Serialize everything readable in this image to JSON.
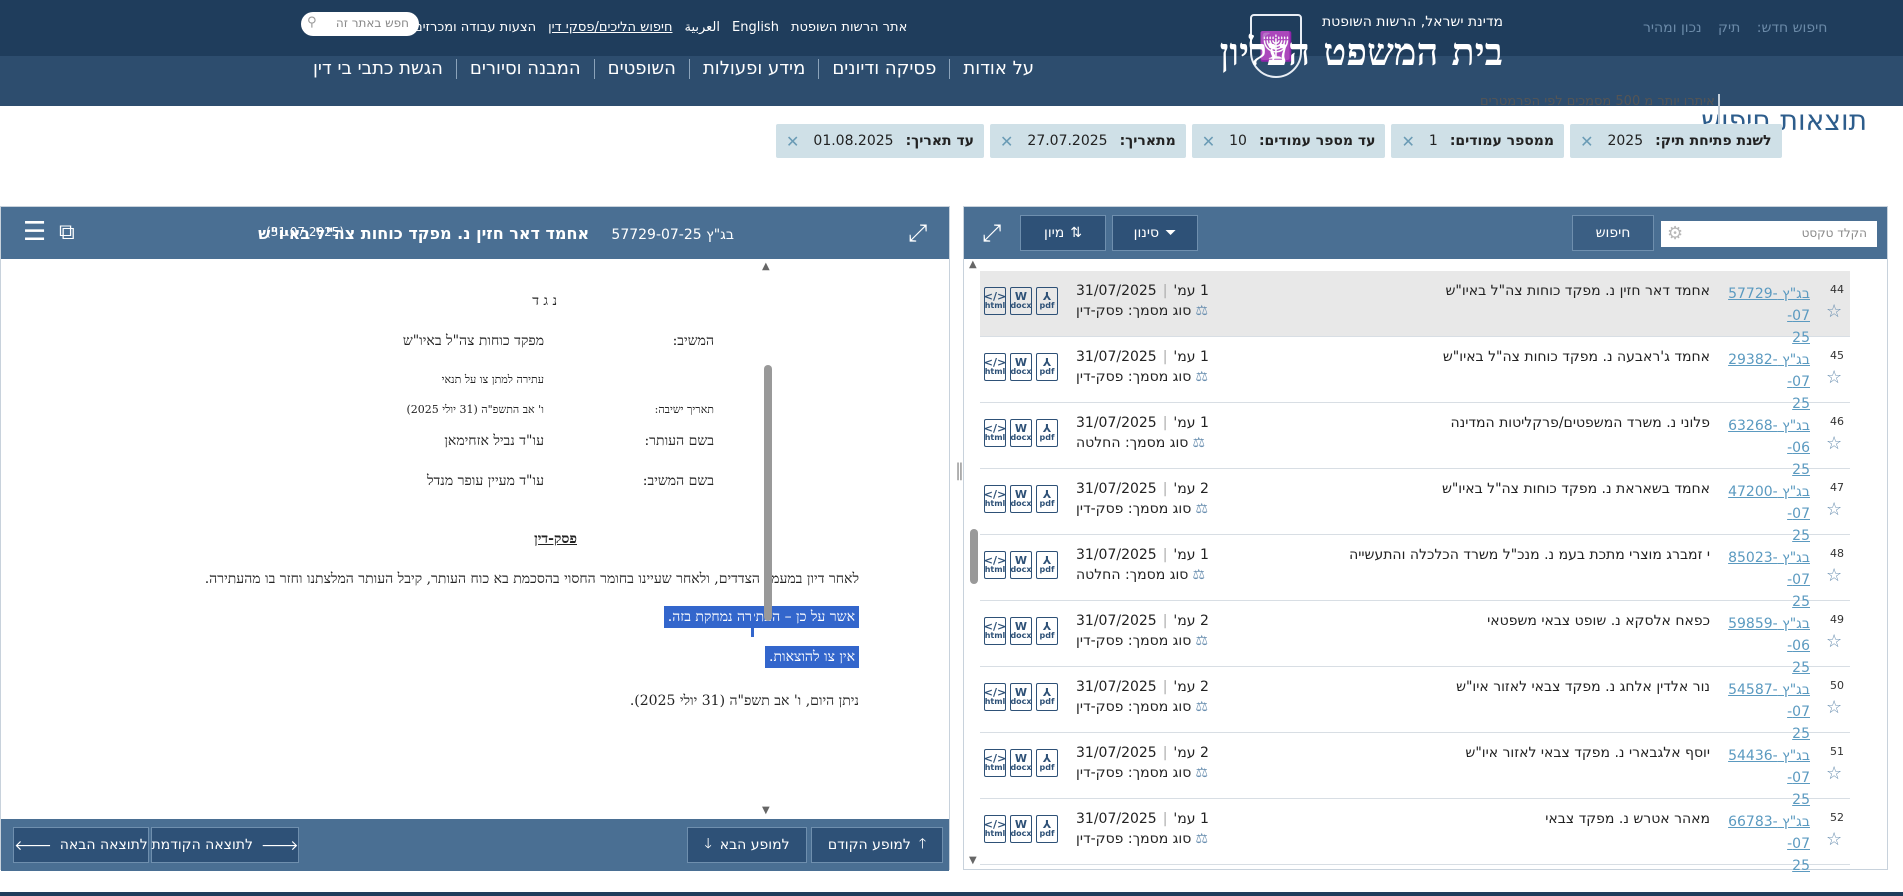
{
  "header": {
    "org_line": "מדינת ישראל, הרשות השופטת",
    "site_title": "בית המשפט העליון",
    "ghost_links": [
      "חיפוש חדש:",
      "תיק",
      "נכון ומהיר"
    ],
    "top_links": [
      "אתר הרשות השופטת",
      "English",
      "العربية",
      "חיפוש הליכים/פסקי דין",
      "הצעות עבודה ומכרזים"
    ],
    "search_placeholder": "חפש באתר זה",
    "nav": [
      "על אודות",
      "פסיקה ודיונים",
      "מידע ופעולות",
      "השופטים",
      "המבנה וסיורים",
      "הגשת כתבי בי דין"
    ]
  },
  "results": {
    "title": "תוצאות חיפוש",
    "notice": "איתרו יותר מ 500 מסמכים לפי הפרמטרים",
    "chips": [
      {
        "label": "לשנת פתיחת תיק:",
        "value": "2025"
      },
      {
        "label": "ממספר עמודים:",
        "value": "1"
      },
      {
        "label": "עד מספר עמודים:",
        "value": "10"
      },
      {
        "label": "מתאריך:",
        "value": "27.07.2025"
      },
      {
        "label": "עד תאריך:",
        "value": "01.08.2025"
      }
    ]
  },
  "viewer": {
    "case_no": "בג\"ץ 57729-07-25",
    "case_title": "אחמד דאר חזין נ. מפקד כוחות צה\"ל באיו\"ש",
    "case_date": "(31.07.2025)",
    "doc": {
      "against": "נ ג ד",
      "respondent_label": "המשיב:",
      "respondent": "מפקד כוחות צה\"ל באיו\"ש",
      "petition_desc": "עתירה למתן צו על תנאי",
      "hearing_label": "תאריך ישיבה:",
      "hearing_date": "ו' אב התשפ\"ה (31 יולי 2025)",
      "petitioner_counsel_label": "בשם העותר:",
      "petitioner_counsel": "עו\"ד נביל אזחימאן",
      "respondent_counsel_label": "בשם המשיב:",
      "respondent_counsel": "עו\"ד מעיין עופר מנדל",
      "heading": "פסק-דין",
      "para1": "לאחר דיון במעמד הצדדים, ולאחר שעיינו בחומר החסוי בהסכמת בא כוח העותר, קיבל העותר המלצתנו וחזר בו מהעתירה.",
      "para2": "אשר על כן – העתירה נמחקת בזה.",
      "para3": "אין צו להוצאות.",
      "para4": "ניתן היום, ו' אב תשפ\"ה (31 יולי 2025)."
    },
    "footer": {
      "prev_occ": "למופע הקודם",
      "next_occ": "למופע הבא",
      "prev_result": "לתוצאה הקודמת",
      "next_result": "לתוצאה הבאה"
    }
  },
  "list": {
    "search_placeholder": "הקלד טקסט",
    "search_btn": "חיפוש",
    "filter_btn": "סינון",
    "sort_btn": "מיון",
    "doc_type_prefix": "סוג מסמך:",
    "rows": [
      {
        "num": "44",
        "case_a": "בג\"ץ 57729-07-",
        "case_b": "25",
        "title": "אחמד דאר חזין נ. מפקד כוחות צה\"ל באיו\"ש",
        "date": "31/07/2025",
        "pages": "1 עמ'",
        "type": "פסק-דין"
      },
      {
        "num": "45",
        "case_a": "בג\"ץ 29382-07-",
        "case_b": "25",
        "title": "אחמד ג'ראבעה נ. מפקד כוחות צה\"ל באיו\"ש",
        "date": "31/07/2025",
        "pages": "1 עמ'",
        "type": "פסק-דין"
      },
      {
        "num": "46",
        "case_a": "בג\"ץ 63268-06-",
        "case_b": "25",
        "title": "פלוני נ. משרד המשפטים/פרקליטות המדינה",
        "date": "31/07/2025",
        "pages": "1 עמ'",
        "type": "החלטה"
      },
      {
        "num": "47",
        "case_a": "בג\"ץ 47200-07-",
        "case_b": "25",
        "title": "אחמד בשאראת נ. מפקד כוחות צה\"ל באיו\"ש",
        "date": "31/07/2025",
        "pages": "2 עמ'",
        "type": "פסק-דין"
      },
      {
        "num": "48",
        "case_a": "בג\"ץ 85023-07-",
        "case_b": "25",
        "title": "י זמברג מוצרי מתכת בעמ נ. מנכ\"ל משרד הכלכלה והתעשייה",
        "date": "31/07/2025",
        "pages": "1 עמ'",
        "type": "החלטה"
      },
      {
        "num": "49",
        "case_a": "בג\"ץ 59859-06-",
        "case_b": "25",
        "title": "כפאח אלסקא נ. שופט צבאי משפטאי",
        "date": "31/07/2025",
        "pages": "2 עמ'",
        "type": "פסק-דין"
      },
      {
        "num": "50",
        "case_a": "בג\"ץ 54587-07-",
        "case_b": "25",
        "title": "נור אלדין אלחג נ. מפקד צבאי לאזור איו\"ש",
        "date": "31/07/2025",
        "pages": "2 עמ'",
        "type": "פסק-דין"
      },
      {
        "num": "51",
        "case_a": "בג\"ץ 54436-07-",
        "case_b": "25",
        "title": "יוסף אלגבארי נ. מפקד צבאי לאזור איו\"ש",
        "date": "31/07/2025",
        "pages": "2 עמ'",
        "type": "פסק-דין"
      },
      {
        "num": "52",
        "case_a": "בג\"ץ 66783-07-",
        "case_b": "25",
        "title": "מאהר אטרש נ. מפקד צבאי",
        "date": "31/07/2025",
        "pages": "1 עמ'",
        "type": "פסק-דין"
      }
    ]
  },
  "colors": {
    "topbar": "#1f3d5c",
    "panel_header": "#4a6f93",
    "button": "#2e5177",
    "chip": "#cfe0e7",
    "link": "#5b9ac0",
    "highlight": "#3366cc"
  }
}
